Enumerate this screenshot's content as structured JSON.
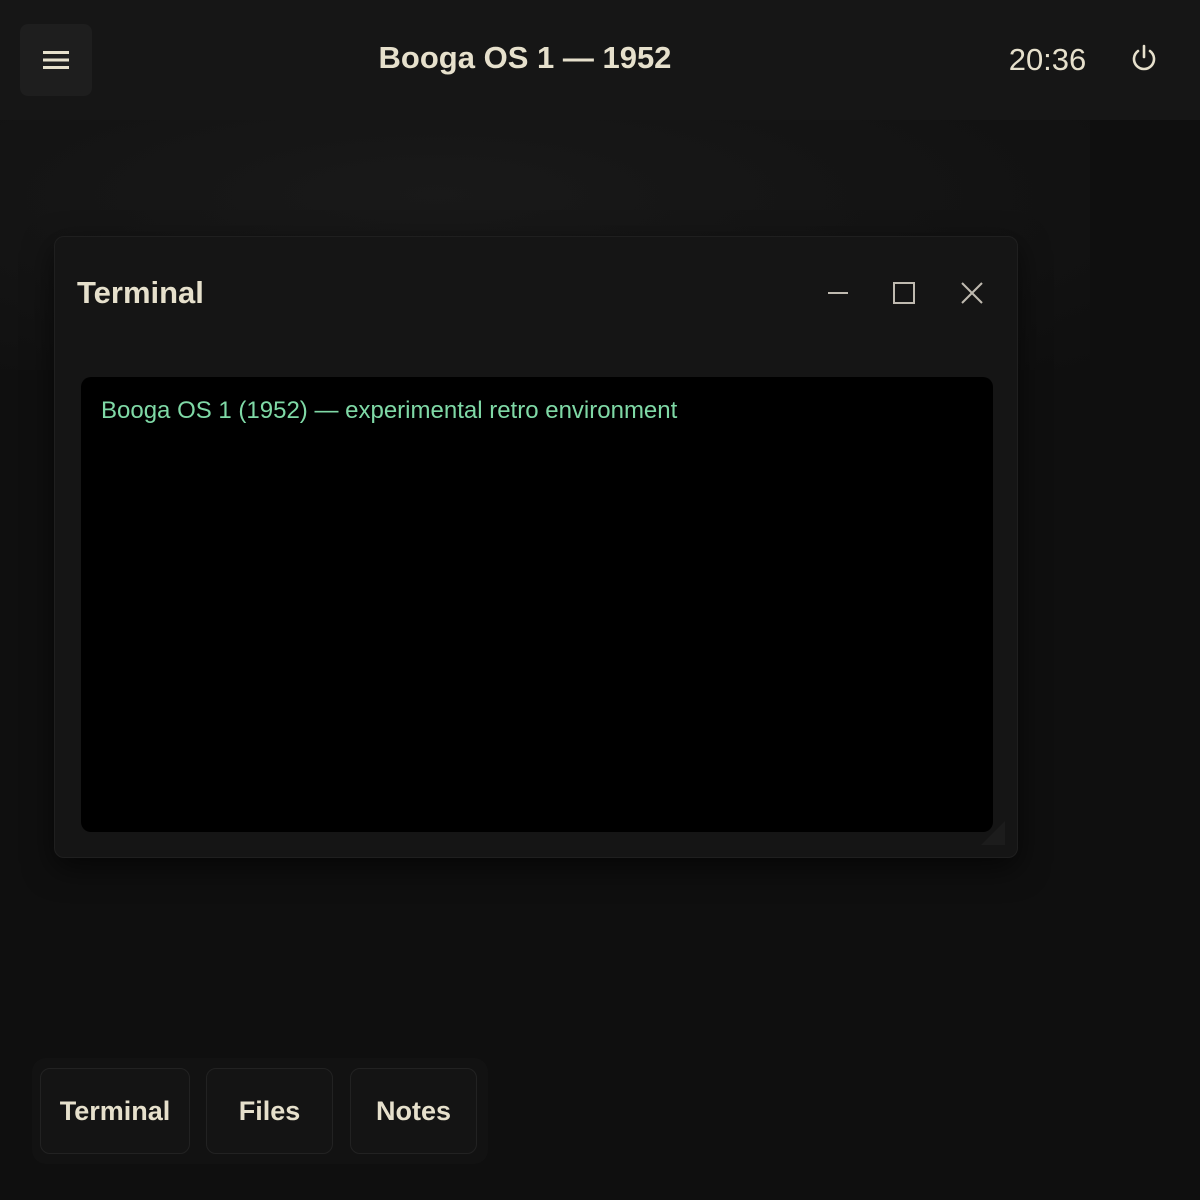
{
  "topbar": {
    "menu_icon": "hamburger-menu-icon",
    "title": "Booga OS 1 — 1952",
    "clock": "20:36",
    "power_icon": "power-icon"
  },
  "window": {
    "title": "Terminal",
    "controls": {
      "minimize_icon": "minimize-icon",
      "maximize_icon": "maximize-icon",
      "close_icon": "close-icon"
    },
    "terminal": {
      "lines": [
        "Booga OS 1 (1952) — experimental retro environment"
      ],
      "text_color": "#7fd9a6"
    }
  },
  "dock": {
    "items": [
      {
        "label": "Terminal"
      },
      {
        "label": "Files"
      },
      {
        "label": "Notes"
      }
    ]
  },
  "colors": {
    "background": "#0f0f0f",
    "topbar": "#161616",
    "text": "#e6e0cc",
    "terminal_bg": "#000000",
    "terminal_text": "#7fd9a6"
  }
}
